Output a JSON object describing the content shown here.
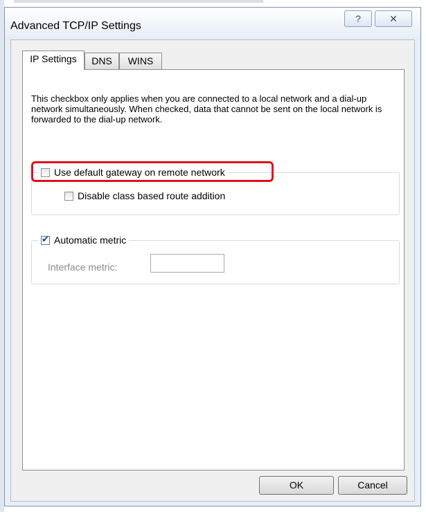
{
  "window": {
    "title": "Advanced TCP/IP Settings",
    "help_glyph": "?",
    "close_glyph": "✕"
  },
  "tabs": [
    {
      "label": "IP Settings",
      "active": true
    },
    {
      "label": "DNS",
      "active": false
    },
    {
      "label": "WINS",
      "active": false
    }
  ],
  "ip_settings": {
    "description": "This checkbox only applies when you are connected to a local network and a dial-up network simultaneously.  When checked, data that cannot be sent on the local network is forwarded to the dial-up network.",
    "use_default_gateway": {
      "label": "Use default gateway on remote network",
      "checked": false
    },
    "disable_class_route": {
      "label": "Disable class based route addition",
      "checked": false
    },
    "automatic_metric": {
      "label": "Automatic metric",
      "checked": true
    },
    "interface_metric": {
      "label": "Interface metric:",
      "value": ""
    }
  },
  "buttons": {
    "ok": "OK",
    "cancel": "Cancel"
  },
  "annotation": {
    "highlight_color": "#e0101a"
  }
}
